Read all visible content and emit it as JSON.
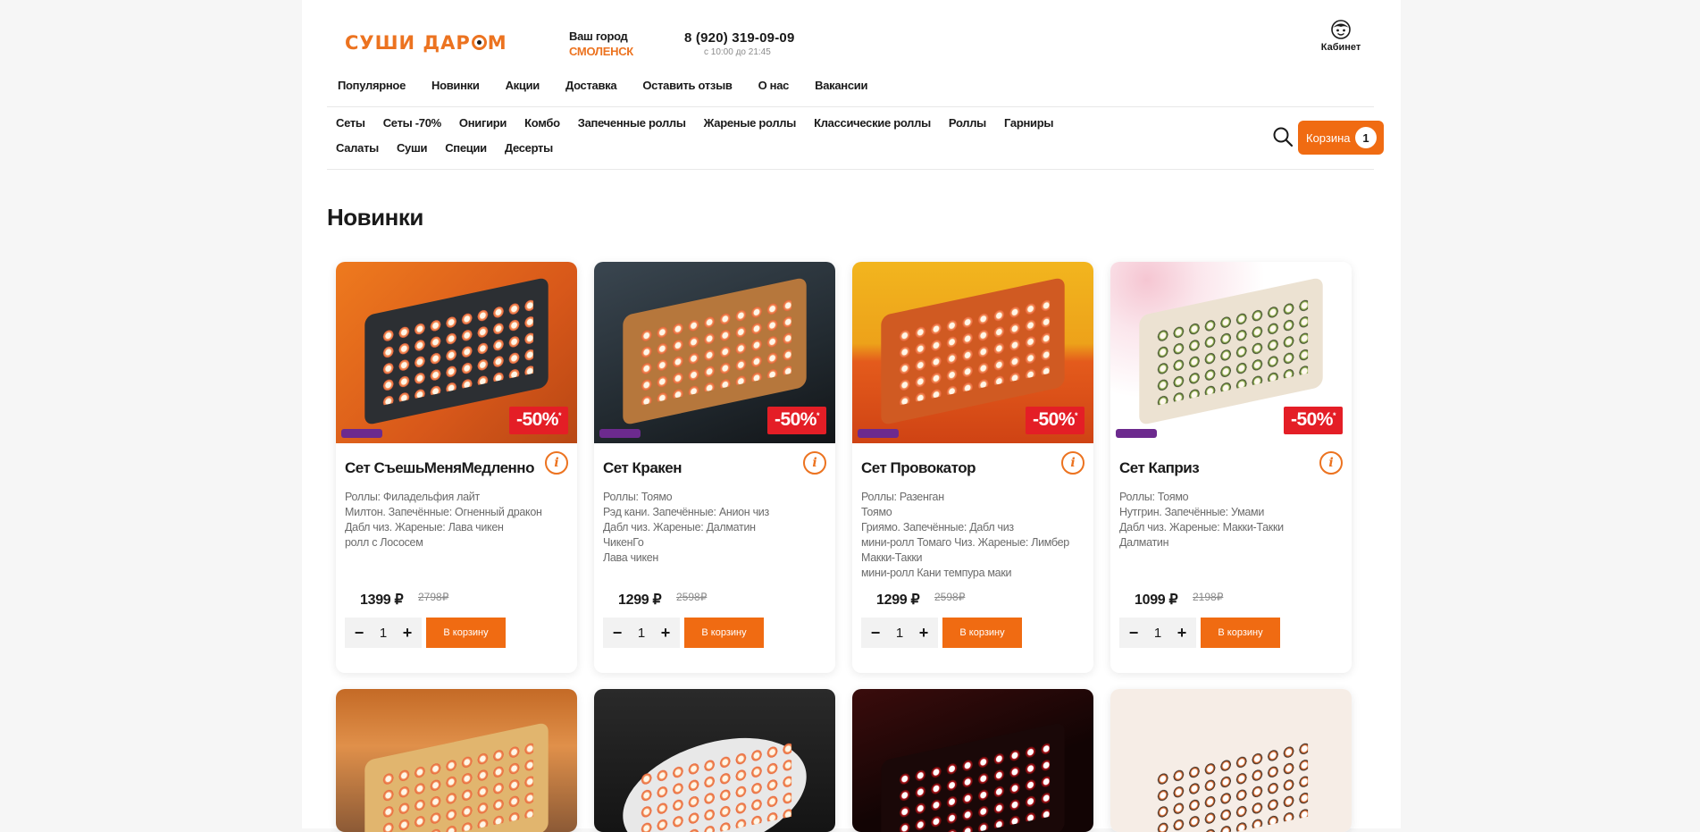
{
  "header": {
    "logo_a": "СУШИ ДАР",
    "logo_b": "М",
    "city_label": "Ваш город",
    "city_name": "СМОЛЕНСК",
    "phone": "8 (920) 319-09-09",
    "hours": "с 10:00 до 21:45",
    "cabinet": "Кабинет"
  },
  "top_nav": [
    "Популярное",
    "Новинки",
    "Акции",
    "Доставка",
    "Оставить отзыв",
    "О нас",
    "Вакансии"
  ],
  "categories": [
    "Сеты",
    "Сеты -70%",
    "Онигири",
    "Комбо",
    "Запеченные роллы",
    "Жареные роллы",
    "Классические роллы",
    "Роллы",
    "Гарниры",
    "Салаты",
    "Суши",
    "Специи",
    "Десерты"
  ],
  "cart": {
    "label": "Корзина",
    "count": "1"
  },
  "section_title": "Новинки",
  "colors": {
    "accent": "#f06b12",
    "discount": "#e41e26",
    "logo": "#ec7320"
  },
  "products": [
    {
      "name": "Сет СъешьМеняМедленно",
      "description": "Роллы: Филадельфия лайт\nМилтон. Запечённые: Огненный дракон\nДабл чиз. Жареные: Лава чикен\nролл с Лососем",
      "price": "1399 ₽",
      "old_price": "2798₽",
      "discount": "-50%",
      "discount_mark": "*",
      "qty": "1",
      "add_label": "В корзину",
      "info": "i"
    },
    {
      "name": "Сет Кракен",
      "description": "Роллы: Тоямо\nРэд кани. Запечённые: Анион чиз\nДабл чиз. Жареные: Далматин\nЧикенГо\nЛава чикен",
      "price": "1299 ₽",
      "old_price": "2598₽",
      "discount": "-50%",
      "discount_mark": "*",
      "qty": "1",
      "add_label": "В корзину",
      "info": "i"
    },
    {
      "name": "Сет Провокатор",
      "description": "Роллы: Разенган\nТоямо\nГриямо. Запечённые: Дабл чиз\nмини-ролл Томаго Чиз. Жареные: Лимбер\nМакки-Такки\nмини-ролл Кани темпура маки",
      "price": "1299 ₽",
      "old_price": "2598₽",
      "discount": "-50%",
      "discount_mark": "*",
      "qty": "1",
      "add_label": "В корзину",
      "info": "i"
    },
    {
      "name": "Сет Каприз",
      "description": "Роллы: Тоямо\nНутгрин. Запечённые: Умами\nДабл чиз. Жареные: Макки-Такки\nДалматин",
      "price": "1099 ₽",
      "old_price": "2198₽",
      "discount": "-50%",
      "discount_mark": "*",
      "qty": "1",
      "add_label": "В корзину",
      "info": "i"
    }
  ],
  "icons": {
    "search": "search-icon",
    "user": "user-icon",
    "info": "info-icon",
    "minus": "minus-icon",
    "plus": "plus-icon"
  },
  "stepper": {
    "minus": "−",
    "plus": "+"
  }
}
